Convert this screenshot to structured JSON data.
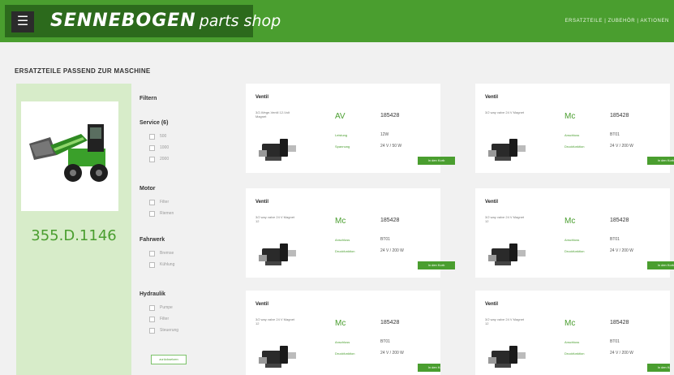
{
  "header": {
    "menu_icon": "hamburger-menu-icon",
    "logo_text": "SENNEBOGEN",
    "logo_sub": "parts shop",
    "top_link": "ERSATZTEILE | ZUBEHÖR | AKTIONEN",
    "colors": {
      "brand_green": "#4a9e2f",
      "dark_green": "#2c6a1c"
    }
  },
  "section": {
    "title": "ERSATZTEILE PASSEND ZUR MASCHINE"
  },
  "machine": {
    "id": "355.D.1146",
    "image_icon": "telehandler-machine-icon"
  },
  "filter": {
    "title": "Filtern",
    "groups": [
      {
        "title": "Service (6)",
        "options": [
          "500",
          "1000",
          "2000"
        ]
      },
      {
        "title": "Motor",
        "options": [
          "Filter",
          "Riemen"
        ]
      },
      {
        "title": "Fahrwerk",
        "options": [
          "Bremse",
          "Kühlung"
        ]
      },
      {
        "title": "Hydraulik",
        "options": [
          "Pumpe",
          "Filter",
          "Steuerung"
        ]
      }
    ],
    "reset_label": "zurücksetzen"
  },
  "products": [
    {
      "title": "Ventil",
      "desc": "3/2-Wege-Ventil 12-Volt Magnet",
      "brand": "AV",
      "number": "185428",
      "k1": "Leistung",
      "v1": "12W",
      "k2": "Spannung",
      "v2": "24 V / 50 W",
      "cart": "In den Korb"
    },
    {
      "title": "Ventil",
      "desc": "3/2 way valve 24 V Magnet",
      "brand": "Mc",
      "number": "185428",
      "k1": "Anschluss",
      "v1": "BT01",
      "k2": "Druckfunktion",
      "v2": "24 V / 200 W",
      "cart": "In den Korb"
    },
    {
      "title": "Ventil",
      "desc": "3/2 way valve 24 V Magnet 12",
      "brand": "Mc",
      "number": "185428",
      "k1": "Anschluss",
      "v1": "BT01",
      "k2": "Druckfunktion",
      "v2": "24 V / 200 W",
      "cart": "In den Korb"
    },
    {
      "title": "Ventil",
      "desc": "3/2 way valve 24 V Magnet 12",
      "brand": "Mc",
      "number": "185428",
      "k1": "Anschluss",
      "v1": "BT01",
      "k2": "Druckfunktion",
      "v2": "24 V / 200 W",
      "cart": "In den Korb"
    },
    {
      "title": "Ventil",
      "desc": "3/2 way valve 24 V Magnet 12",
      "brand": "Mc",
      "number": "185428",
      "k1": "Anschluss",
      "v1": "BT01",
      "k2": "Druckfunktion",
      "v2": "24 V / 200 W",
      "cart": "In den Korb"
    },
    {
      "title": "Ventil",
      "desc": "3/2 way valve 24 V Magnet 12",
      "brand": "Mc",
      "number": "185428",
      "k1": "Anschluss",
      "v1": "BT01",
      "k2": "Druckfunktion",
      "v2": "24 V / 200 W",
      "cart": "In den Korb"
    }
  ]
}
